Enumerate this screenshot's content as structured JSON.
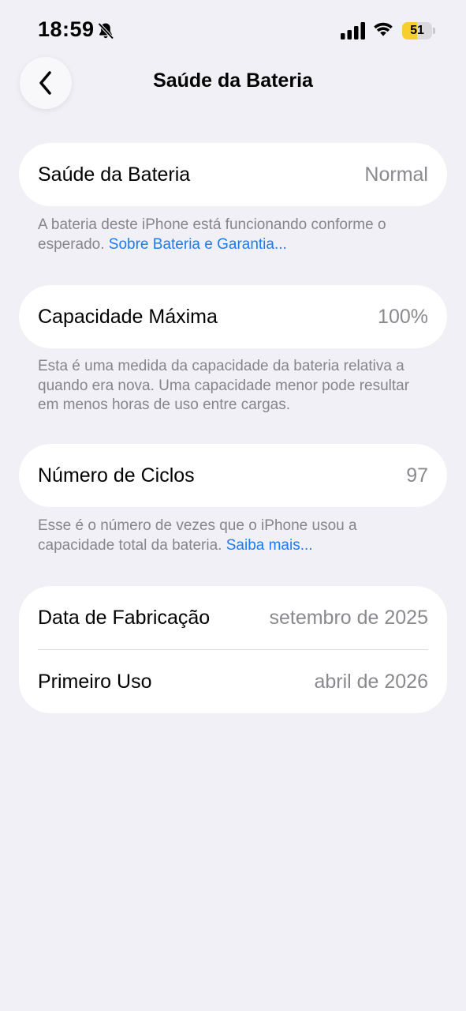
{
  "status_bar": {
    "time": "18:59",
    "battery_level": "51",
    "battery_fraction": 0.51,
    "battery_color": "#f6cf2f",
    "icons": [
      "bell-slash-icon",
      "cellular-signal-icon",
      "wifi-icon",
      "battery-icon"
    ]
  },
  "nav": {
    "title": "Saúde da Bateria",
    "back_icon": "chevron-left-icon"
  },
  "battery_health": {
    "label": "Saúde da Bateria",
    "value": "Normal",
    "footnote": "A bateria deste iPhone está funcionando conforme o esperado.",
    "link": "Sobre Bateria e Garantia..."
  },
  "max_capacity": {
    "label": "Capacidade Máxima",
    "value": "100%",
    "footnote": "Esta é uma medida da capacidade da bateria relativa a quando era nova. Uma capacidade menor pode resultar em menos horas de uso entre cargas."
  },
  "cycle_count": {
    "label": "Número de Ciclos",
    "value": "97",
    "footnote": "Esse é o número de vezes que o iPhone usou a capacidade total da bateria.",
    "link": "Saiba mais..."
  },
  "dates": {
    "manufacture_label": "Data de Fabricação",
    "manufacture_value": "setembro de 2025",
    "first_use_label": "Primeiro Uso",
    "first_use_value": "abril de 2026"
  },
  "colors": {
    "background": "#f0f0f6",
    "card": "#ffffff",
    "link": "#1a7cf5",
    "secondary_text": "#8a8a8e"
  }
}
